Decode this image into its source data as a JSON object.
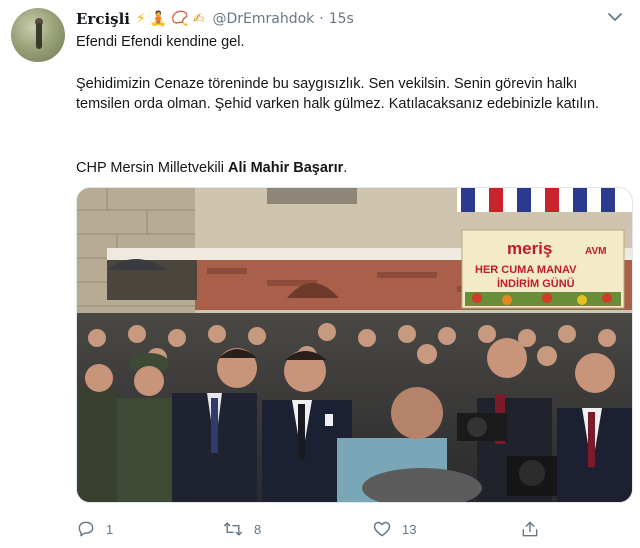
{
  "tweet": {
    "display_name": "Ercişli",
    "name_emojis": [
      "⚡",
      "🧘",
      "📿",
      "✍"
    ],
    "handle": "@DrEmrahdok",
    "separator": "·",
    "time": "15s",
    "lines": {
      "line1": "Efendi Efendi kendine gel.",
      "line2": "Şehidimizin Cenaze töreninde bu saygısızlık. Sen vekilsin. Senin görevin halkı temsilen orda olman. Şehid varken halk gülmez. Katılacaksanız edebinizle katılın.",
      "line3_prefix": "CHP Mersin Milletvekili ",
      "line3_bold": "Ali Mahir Başarır",
      "line3_suffix": "."
    },
    "photo": {
      "banner_brand": "meriş",
      "banner_brand_suffix": "AVM",
      "banner_line1": "HER CUMA MANAV",
      "banner_line2": "İNDİRİM GÜNÜ"
    },
    "actions": {
      "reply_count": "1",
      "retweet_count": "8",
      "like_count": "13"
    }
  },
  "colors": {
    "text": "#14171a",
    "secondary": "#657786",
    "border": "#e1e8ed"
  },
  "icons": {
    "reply": "reply-icon",
    "retweet": "retweet-icon",
    "like": "heart-icon",
    "share": "share-icon",
    "more": "chevron-down-icon"
  }
}
